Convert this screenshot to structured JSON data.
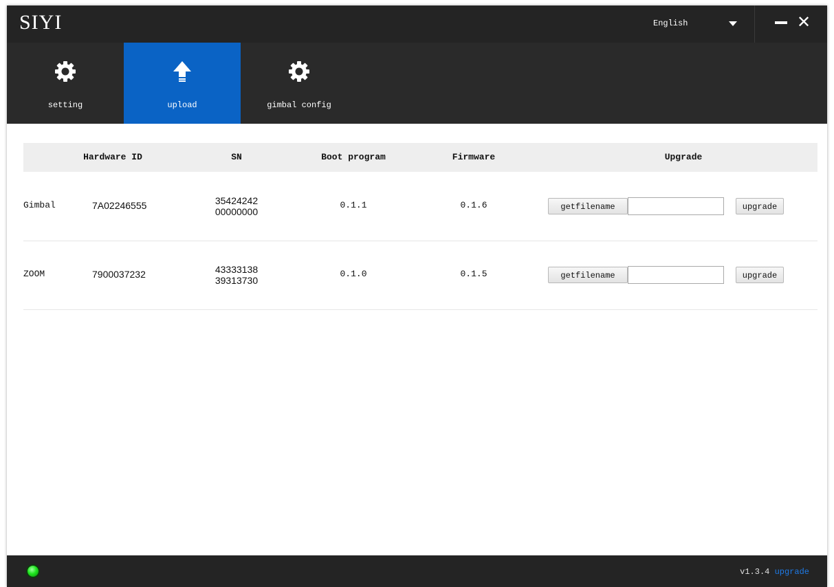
{
  "window": {
    "logo": "SIYI"
  },
  "titlebar": {
    "language": "English",
    "minimize_icon": "minimize-icon",
    "close_icon": "close-icon"
  },
  "tabs": [
    {
      "label": "setting",
      "icon": "gear-icon",
      "active": false
    },
    {
      "label": "upload",
      "icon": "upload-arrow-icon",
      "active": true
    },
    {
      "label": "gimbal config",
      "icon": "gear-icon",
      "active": false
    }
  ],
  "table": {
    "headers": {
      "hardware_id": "Hardware ID",
      "sn": "SN",
      "boot_program": "Boot program",
      "firmware": "Firmware",
      "upgrade": "Upgrade"
    },
    "rows": [
      {
        "device": "Gimbal",
        "hardware_id": "7A02246555",
        "sn_line1": "35424242",
        "sn_line2": "00000000",
        "boot_program": "0.1.1",
        "firmware": "0.1.6",
        "getfile_label": "getfilename",
        "file_value": "",
        "upgrade_label": "upgrade"
      },
      {
        "device": "ZOOM",
        "hardware_id": "7900037232",
        "sn_line1": "43333138",
        "sn_line2": "39313730",
        "boot_program": "0.1.0",
        "firmware": "0.1.5",
        "getfile_label": "getfilename",
        "file_value": "",
        "upgrade_label": "upgrade"
      }
    ]
  },
  "statusbar": {
    "connection_led_color": "#1ee61e",
    "version": "v1.3.4",
    "upgrade_link": "upgrade"
  },
  "colors": {
    "accent": "#0a63c5",
    "titlebar_bg": "#242424",
    "link": "#1e7ae6"
  }
}
